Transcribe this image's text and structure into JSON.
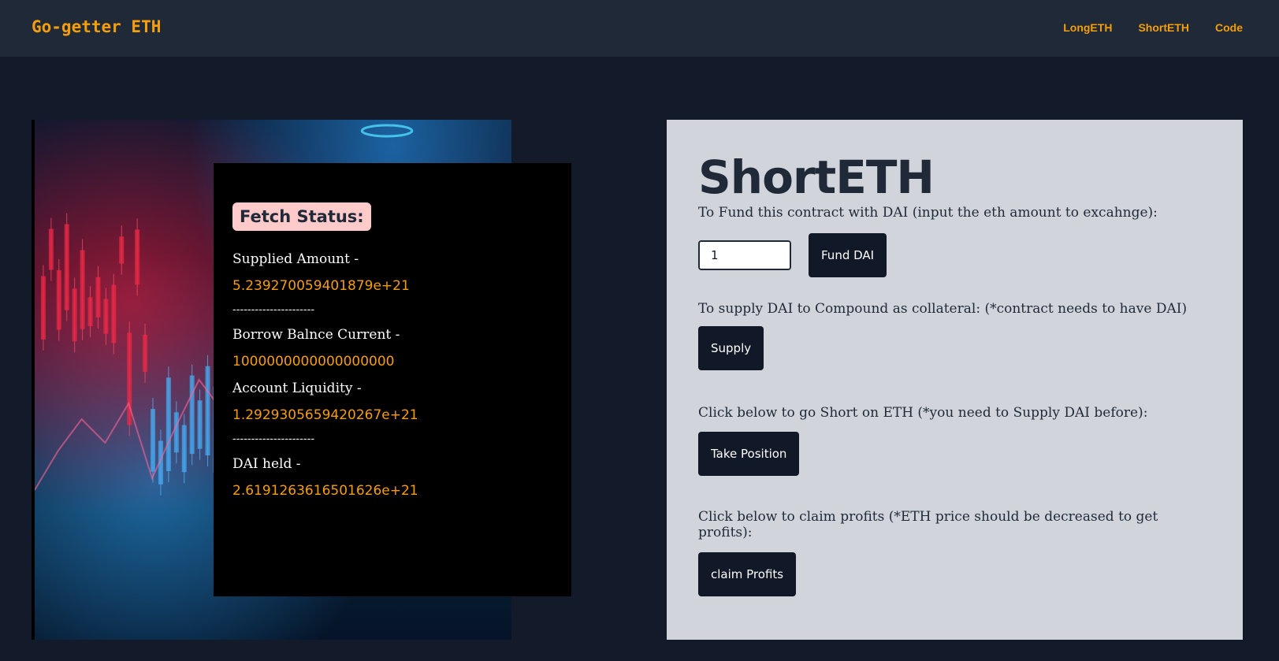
{
  "navbar": {
    "brand": "Go-getter ETH",
    "links": [
      "LongETH",
      "ShortETH",
      "Code"
    ]
  },
  "status": {
    "title": "Fetch Status:",
    "supplied_label": "Supplied Amount -",
    "supplied_value": "5.239270059401879e+21",
    "divider1": "----------------------",
    "borrow_label": "Borrow Balnce Current -",
    "borrow_value": "1000000000000000000",
    "liquidity_label": "Account Liquidity -",
    "liquidity_value": "1.2929305659420267e+21",
    "divider2": "----------------------",
    "dai_label": "DAI held -",
    "dai_value": "2.6191263616501626e+21"
  },
  "panel": {
    "title": "ShortETH",
    "fund_instruction": "To Fund this contract with DAI (input the eth amount to excahnge):",
    "fund_input_value": "1",
    "fund_button": "Fund DAI",
    "supply_instruction": "To supply DAI to Compound as collateral: (*contract needs to have DAI)",
    "supply_button": "Supply",
    "position_instruction": "Click below to go Short on ETH (*you need to Supply DAI before):",
    "position_button": "Take Position",
    "claim_instruction": "Click below to claim profits (*ETH price should be decreased to get profits):",
    "claim_button": "claim Profits"
  },
  "colors": {
    "accent": "#f59e0b",
    "navbar_bg": "#1f2937",
    "page_bg": "#131a29",
    "panel_bg": "#d1d5db",
    "button_bg": "#111827",
    "status_title_bg": "#fecaca"
  }
}
